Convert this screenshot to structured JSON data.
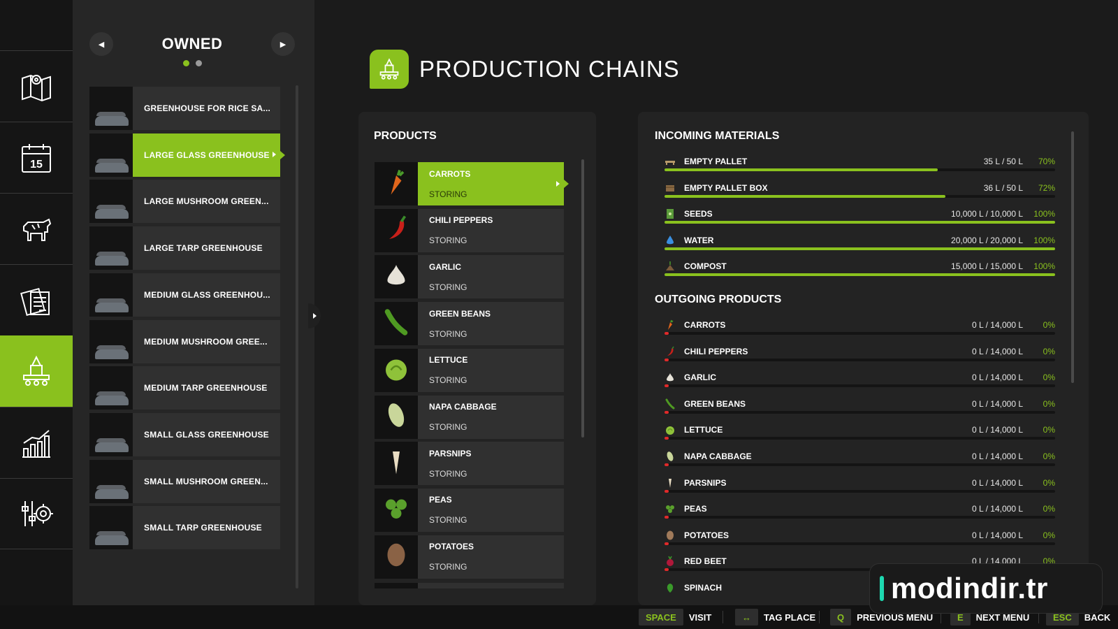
{
  "nav": {
    "items": [
      {
        "icon": "map-icon"
      },
      {
        "icon": "calendar-icon",
        "day": "15"
      },
      {
        "icon": "animals-icon"
      },
      {
        "icon": "contracts-icon"
      },
      {
        "icon": "production-icon",
        "active": true
      },
      {
        "icon": "statistics-icon"
      },
      {
        "icon": "settings-icon"
      }
    ]
  },
  "list": {
    "title": "OWNED",
    "prev_glyph": "◀",
    "next_glyph": "▶",
    "page_count": 2,
    "current_page": 1,
    "items": [
      {
        "label": "GREENHOUSE FOR RICE SA..."
      },
      {
        "label": "LARGE GLASS GREENHOUSE",
        "selected": true
      },
      {
        "label": "LARGE MUSHROOM GREEN..."
      },
      {
        "label": "LARGE TARP GREENHOUSE"
      },
      {
        "label": "MEDIUM GLASS GREENHOU..."
      },
      {
        "label": "MEDIUM MUSHROOM GREE..."
      },
      {
        "label": "MEDIUM TARP GREENHOUSE"
      },
      {
        "label": "SMALL GLASS GREENHOUSE"
      },
      {
        "label": "SMALL MUSHROOM GREEN..."
      },
      {
        "label": "SMALL TARP GREENHOUSE"
      }
    ]
  },
  "header": {
    "title": "PRODUCTION CHAINS",
    "icon": "production-icon"
  },
  "products": {
    "title": "PRODUCTS",
    "items": [
      {
        "name": "CARROTS",
        "status": "STORING",
        "icon": "carrot-icon",
        "color": "#e0661c",
        "selected": true
      },
      {
        "name": "CHILI PEPPERS",
        "status": "STORING",
        "icon": "chili-pepper-icon",
        "color": "#c8201a"
      },
      {
        "name": "GARLIC",
        "status": "STORING",
        "icon": "garlic-icon",
        "color": "#e6e2d8"
      },
      {
        "name": "GREEN BEANS",
        "status": "STORING",
        "icon": "green-beans-icon",
        "color": "#4f9a22"
      },
      {
        "name": "LETTUCE",
        "status": "STORING",
        "icon": "lettuce-icon",
        "color": "#8fc23a"
      },
      {
        "name": "NAPA CABBAGE",
        "status": "STORING",
        "icon": "napa-cabbage-icon",
        "color": "#c9d69a"
      },
      {
        "name": "PARSNIPS",
        "status": "STORING",
        "icon": "parsnip-icon",
        "color": "#e9ddc3"
      },
      {
        "name": "PEAS",
        "status": "STORING",
        "icon": "peas-icon",
        "color": "#5aa02c"
      },
      {
        "name": "POTATOES",
        "status": "STORING",
        "icon": "potato-icon",
        "color": "#8a6245"
      }
    ]
  },
  "incoming": {
    "title": "INCOMING MATERIALS",
    "items": [
      {
        "name": "EMPTY PALLET",
        "amount": "35 L / 50 L",
        "percent": "70%",
        "fill": 0.7,
        "icon": "pallet-icon",
        "color": "#b89a6a"
      },
      {
        "name": "EMPTY PALLET BOX",
        "amount": "36 L / 50 L",
        "percent": "72%",
        "fill": 0.72,
        "icon": "pallet-box-icon",
        "color": "#8b6a44"
      },
      {
        "name": "SEEDS",
        "amount": "10,000 L / 10,000 L",
        "percent": "100%",
        "fill": 1.0,
        "icon": "seeds-icon",
        "color": "#5a9a3a"
      },
      {
        "name": "WATER",
        "amount": "20,000 L / 20,000 L",
        "percent": "100%",
        "fill": 1.0,
        "icon": "water-icon",
        "color": "#3a8fe0"
      },
      {
        "name": "COMPOST",
        "amount": "15,000 L / 15,000 L",
        "percent": "100%",
        "fill": 1.0,
        "icon": "compost-icon",
        "color": "#7a5a3a"
      }
    ]
  },
  "outgoing": {
    "title": "OUTGOING PRODUCTS",
    "items": [
      {
        "name": "CARROTS",
        "amount": "0 L / 14,000 L",
        "percent": "0%",
        "fill": 0,
        "icon": "carrot-icon",
        "color": "#e0661c"
      },
      {
        "name": "CHILI PEPPERS",
        "amount": "0 L / 14,000 L",
        "percent": "0%",
        "fill": 0,
        "icon": "chili-pepper-icon",
        "color": "#c8201a"
      },
      {
        "name": "GARLIC",
        "amount": "0 L / 14,000 L",
        "percent": "0%",
        "fill": 0,
        "icon": "garlic-icon",
        "color": "#e6e2d8"
      },
      {
        "name": "GREEN BEANS",
        "amount": "0 L / 14,000 L",
        "percent": "0%",
        "fill": 0,
        "icon": "green-beans-icon",
        "color": "#4f9a22"
      },
      {
        "name": "LETTUCE",
        "amount": "0 L / 14,000 L",
        "percent": "0%",
        "fill": 0,
        "icon": "lettuce-icon",
        "color": "#8fc23a"
      },
      {
        "name": "NAPA CABBAGE",
        "amount": "0 L / 14,000 L",
        "percent": "0%",
        "fill": 0,
        "icon": "napa-cabbage-icon",
        "color": "#c9d69a"
      },
      {
        "name": "PARSNIPS",
        "amount": "0 L / 14,000 L",
        "percent": "0%",
        "fill": 0,
        "icon": "parsnip-icon",
        "color": "#e9ddc3"
      },
      {
        "name": "PEAS",
        "amount": "0 L / 14,000 L",
        "percent": "0%",
        "fill": 0,
        "icon": "peas-icon",
        "color": "#5aa02c"
      },
      {
        "name": "POTATOES",
        "amount": "0 L / 14,000 L",
        "percent": "0%",
        "fill": 0,
        "icon": "potato-icon",
        "color": "#a07a5a"
      },
      {
        "name": "RED BEET",
        "amount": "0 L / 14,000 L",
        "percent": "0%",
        "fill": 0,
        "icon": "red-beet-icon",
        "color": "#b0183a"
      },
      {
        "name": "SPINACH",
        "amount": "",
        "percent": "",
        "fill": 0,
        "icon": "spinach-icon",
        "color": "#3a9a2a"
      }
    ]
  },
  "bottom_bar": {
    "hints": [
      {
        "key": "SPACE",
        "label": "VISIT"
      },
      {
        "key": "↔",
        "label": "TAG PLACE"
      },
      {
        "key": "Q",
        "label": "PREVIOUS MENU"
      },
      {
        "key": "E",
        "label": "NEXT MENU"
      },
      {
        "key": "ESC",
        "label": "BACK"
      }
    ]
  },
  "watermark": {
    "text": "modindir.tr"
  },
  "colors": {
    "accent": "#8ac11e",
    "empty_bar": "#e02a2a",
    "background": "#1b1b1b",
    "panel": "#262626"
  }
}
